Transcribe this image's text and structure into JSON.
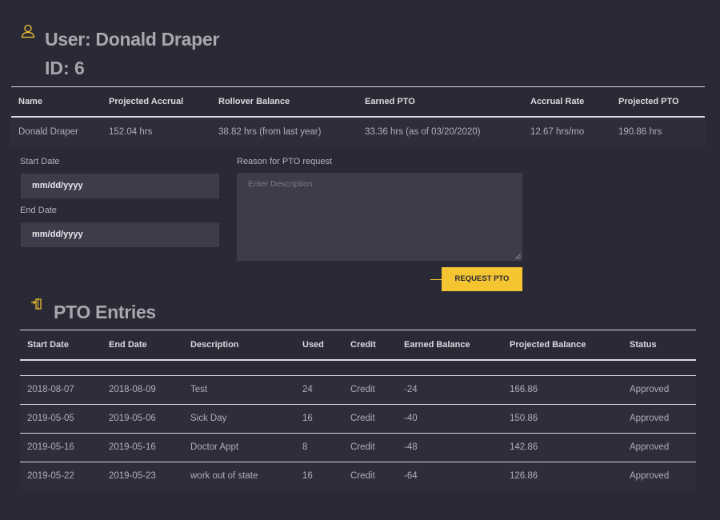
{
  "user": {
    "title": "User: Donald Draper",
    "id_label": "ID: 6"
  },
  "summary": {
    "headers": [
      "Name",
      "Projected Accrual",
      "Rollover Balance",
      "Earned PTO",
      "Accrual Rate",
      "Projected PTO"
    ],
    "row": [
      "Donald Draper",
      "152.04 hrs",
      "38.82 hrs (from last year)",
      "33.36 hrs (as of 03/20/2020)",
      "12.67 hrs/mo",
      "190.86 hrs"
    ]
  },
  "form": {
    "start_label": "Start Date",
    "start_value": "mm/dd/yyyy",
    "end_label": "End Date",
    "end_value": "mm/dd/yyyy",
    "reason_label": "Reason for PTO request",
    "reason_placeholder": "Enter Description",
    "submit_label": "REQUEST PTO"
  },
  "entries": {
    "title": "PTO Entries",
    "headers": [
      "Start Date",
      "End Date",
      "Description",
      "Used",
      "Credit",
      "Earned Balance",
      "Projected Balance",
      "Status"
    ],
    "rows": [
      [
        "2018-08-07",
        "2018-08-09",
        "Test",
        "24",
        "Credit",
        "-24",
        "166.86",
        "Approved"
      ],
      [
        "2019-05-05",
        "2019-05-06",
        "Sick Day",
        "16",
        "Credit",
        "-40",
        "150.86",
        "Approved"
      ],
      [
        "2019-05-16",
        "2019-05-16",
        "Doctor Appt",
        "8",
        "Credit",
        "-48",
        "142.86",
        "Approved"
      ],
      [
        "2019-05-22",
        "2019-05-23",
        "work out of state",
        "16",
        "Credit",
        "-64",
        "126.86",
        "Approved"
      ]
    ]
  },
  "colors": {
    "accent": "#f5c531",
    "background": "#2a2a36",
    "input": "#3c3c4a"
  }
}
